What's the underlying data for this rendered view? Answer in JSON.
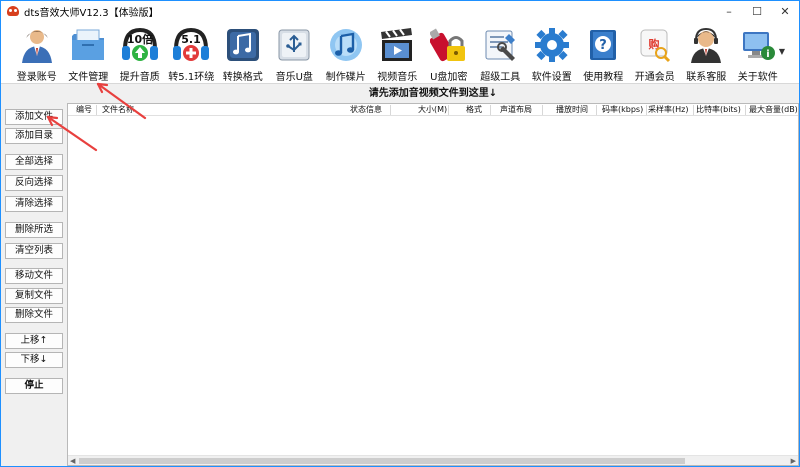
{
  "window": {
    "title": "dts音效大师V12.3【体验版】"
  },
  "toolbar": {
    "items": [
      {
        "label": "登录账号",
        "icon": "user-icon"
      },
      {
        "label": "文件管理",
        "icon": "file-manager-icon"
      },
      {
        "label": "提升音质",
        "icon": "headphone-10x-icon"
      },
      {
        "label": "转5.1环绕",
        "icon": "headphone-5.1-icon"
      },
      {
        "label": "转换格式",
        "icon": "music-convert-icon"
      },
      {
        "label": "音乐U盘",
        "icon": "usb-music-icon"
      },
      {
        "label": "制作碟片",
        "icon": "disc-icon"
      },
      {
        "label": "视频音乐",
        "icon": "film-icon"
      },
      {
        "label": "U盘加密",
        "icon": "usb-lock-icon"
      },
      {
        "label": "超级工具",
        "icon": "toolbox-icon"
      },
      {
        "label": "软件设置",
        "icon": "gear-icon"
      },
      {
        "label": "使用教程",
        "icon": "help-book-icon"
      },
      {
        "label": "开通会员",
        "icon": "shopping-icon"
      },
      {
        "label": "联系客服",
        "icon": "customer-service-icon"
      },
      {
        "label": "关于软件",
        "icon": "computer-icon"
      }
    ],
    "badge_10": "10倍",
    "badge_51": "5.1",
    "badge_buy": "购"
  },
  "hint": "请先添加音视频文件到这里↓",
  "sidebar": {
    "buttons": [
      "添加文件",
      "添加目录",
      "全部选择",
      "反向选择",
      "清除选择",
      "删除所选",
      "清空列表",
      "移动文件",
      "复制文件",
      "删除文件",
      "上移↑",
      "下移↓",
      "停止"
    ]
  },
  "table": {
    "columns": [
      "编号",
      "文件名称",
      "状态信息",
      "大小(M)",
      "格式",
      "声道布局",
      "播放时间",
      "码率(kbps)",
      "采样率(Hz)",
      "比特率(bits)",
      "最大音量(dB)"
    ]
  },
  "colors": {
    "accent": "#1e90ff",
    "arrow": "#e8403e"
  }
}
